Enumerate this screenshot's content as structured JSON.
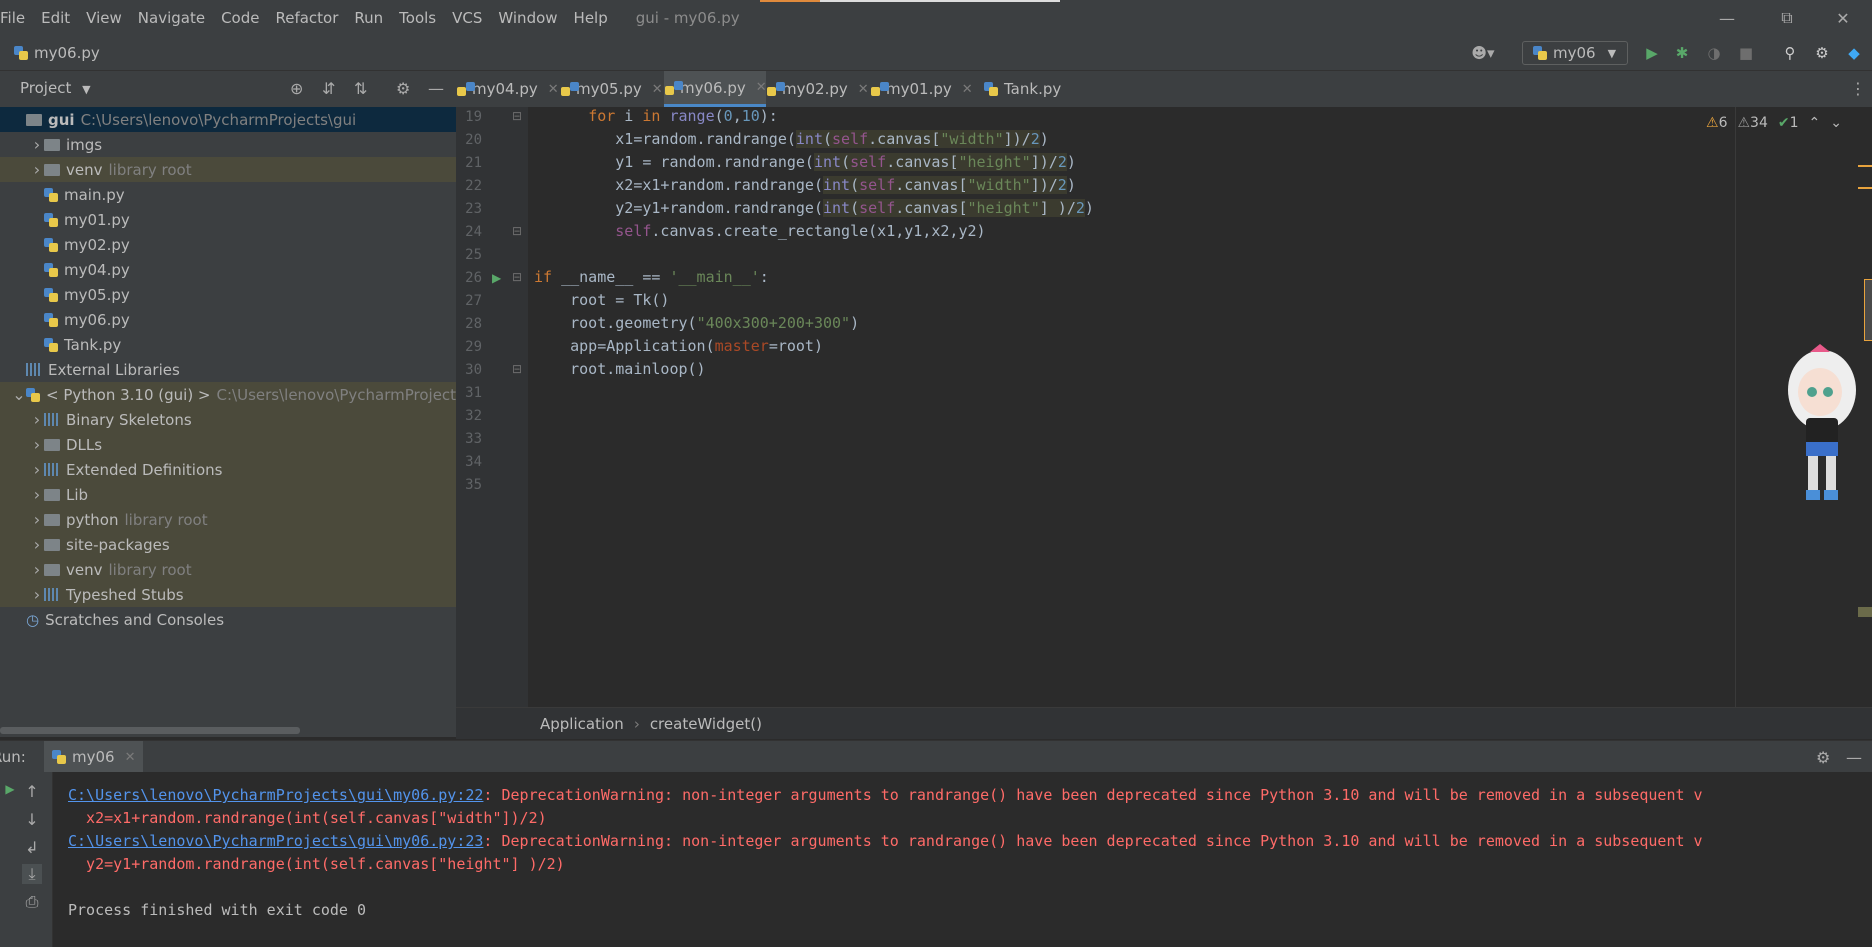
{
  "menu": {
    "items": [
      "File",
      "Edit",
      "View",
      "Navigate",
      "Code",
      "Refactor",
      "Run",
      "Tools",
      "VCS",
      "Window",
      "Help"
    ],
    "window_title": "gui - my06.py"
  },
  "navbar": {
    "current_file": "my06.py",
    "run_config": "my06"
  },
  "project_panel": {
    "title": "Project",
    "tree": [
      {
        "label": "gui",
        "note": "C:\\Users\\lenovo\\PycharmProjects\\gui",
        "type": "folder",
        "level": 0,
        "selected": true
      },
      {
        "label": "imgs",
        "note": "",
        "type": "folder",
        "level": 1,
        "arrow": true
      },
      {
        "label": "venv",
        "note": "library root",
        "type": "folder",
        "level": 1,
        "arrow": true,
        "lib": true
      },
      {
        "label": "main.py",
        "note": "",
        "type": "py",
        "level": 1
      },
      {
        "label": "my01.py",
        "note": "",
        "type": "py",
        "level": 1
      },
      {
        "label": "my02.py",
        "note": "",
        "type": "py",
        "level": 1
      },
      {
        "label": "my04.py",
        "note": "",
        "type": "py",
        "level": 1
      },
      {
        "label": "my05.py",
        "note": "",
        "type": "py",
        "level": 1
      },
      {
        "label": "my06.py",
        "note": "",
        "type": "py",
        "level": 1
      },
      {
        "label": "Tank.py",
        "note": "",
        "type": "py",
        "level": 1
      },
      {
        "label": "External Libraries",
        "note": "",
        "type": "libs",
        "level": 0
      },
      {
        "label": "< Python 3.10 (gui) >",
        "note": "C:\\Users\\lenovo\\PycharmProject",
        "type": "py",
        "level": 0,
        "arrow": true,
        "open": true,
        "lib": true
      },
      {
        "label": "Binary Skeletons",
        "note": "",
        "type": "libs",
        "level": 1,
        "arrow": true,
        "lib": true
      },
      {
        "label": "DLLs",
        "note": "",
        "type": "folder",
        "level": 1,
        "arrow": true,
        "lib": true
      },
      {
        "label": "Extended Definitions",
        "note": "",
        "type": "libs",
        "level": 1,
        "arrow": true,
        "lib": true
      },
      {
        "label": "Lib",
        "note": "",
        "type": "folder",
        "level": 1,
        "arrow": true,
        "lib": true
      },
      {
        "label": "python",
        "note": "library root",
        "type": "folder",
        "level": 1,
        "arrow": true,
        "lib": true
      },
      {
        "label": "site-packages",
        "note": "",
        "type": "folder",
        "level": 1,
        "arrow": true,
        "lib": true
      },
      {
        "label": "venv",
        "note": "library root",
        "type": "folder",
        "level": 1,
        "arrow": true,
        "lib": true
      },
      {
        "label": "Typeshed Stubs",
        "note": "",
        "type": "libs",
        "level": 1,
        "arrow": true,
        "lib": true
      },
      {
        "label": "Scratches and Consoles",
        "note": "",
        "type": "scratch",
        "level": 0
      }
    ]
  },
  "tabs": [
    {
      "label": "my04.py",
      "active": false
    },
    {
      "label": "my05.py",
      "active": false
    },
    {
      "label": "my06.py",
      "active": true
    },
    {
      "label": "my02.py",
      "active": false
    },
    {
      "label": "my01.py",
      "active": false
    },
    {
      "label": "Tank.py",
      "active": false
    }
  ],
  "editor": {
    "line_numbers": [
      "19",
      "20",
      "21",
      "22",
      "23",
      "24",
      "25",
      "26",
      "27",
      "28",
      "29",
      "30",
      "31",
      "32",
      "33",
      "34",
      "35"
    ],
    "inspections": {
      "errors": "6",
      "warnings": "34",
      "ok": "1"
    },
    "breadcrumb": [
      "Application",
      "createWidget()"
    ]
  },
  "run_panel": {
    "label": "Run:",
    "tab": "my06",
    "lines": [
      {
        "link": "C:\\Users\\lenovo\\PycharmProjects\\gui\\my06.py:22",
        "text": ": DeprecationWarning: non-integer arguments to randrange() have been deprecated since Python 3.10 and will be removed in a subsequent v"
      },
      {
        "link": "",
        "text": "  x2=x1+random.randrange(int(self.canvas[\"width\"])/2)"
      },
      {
        "link": "C:\\Users\\lenovo\\PycharmProjects\\gui\\my06.py:23",
        "text": ": DeprecationWarning: non-integer arguments to randrange() have been deprecated since Python 3.10 and will be removed in a subsequent v"
      },
      {
        "link": "",
        "text": "  y2=y1+random.randrange(int(self.canvas[\"height\"] )/2)"
      },
      {
        "link": "",
        "text": ""
      },
      {
        "link": "",
        "text": "Process finished with exit code 0",
        "normal": true
      }
    ]
  },
  "colors": {
    "accent": "#4a88c7",
    "error": "#ff6b68",
    "link": "#5394ec"
  }
}
